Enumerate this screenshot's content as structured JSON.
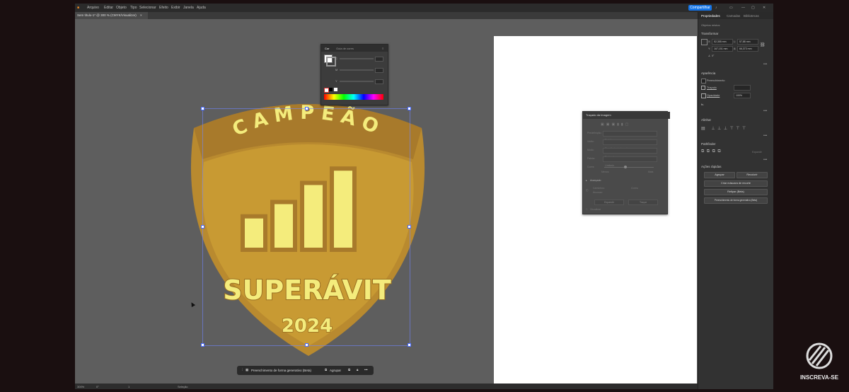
{
  "menubar": {
    "items": [
      "Arquivo",
      "Editar",
      "Objeto",
      "Tipo",
      "Selecionar",
      "Efeito",
      "Exibir",
      "Janela",
      "Ajuda"
    ],
    "share_label": "Compartilhar"
  },
  "document_tab": {
    "title": "Sem título-1* @ 300 % (CMYK/Visualizar)",
    "close": "×"
  },
  "status": {
    "zoom": "300%",
    "rotation": "0°",
    "artboard": "1",
    "tool": "Seleção"
  },
  "color_panel": {
    "tabs": [
      "Cor",
      "Guia de cores"
    ],
    "rows": [
      "C",
      "M",
      "Y"
    ]
  },
  "trace_panel": {
    "title": "Traçado da Imagem",
    "rows": [
      "Predefinição:",
      "Visão:",
      "Modo:",
      "Paleta:",
      "Cores:"
    ],
    "values": [
      "Padrão",
      "Resultado de traçado",
      "Preto e branco",
      "Limitado",
      ""
    ],
    "scale": [
      "Menos",
      "Mais"
    ],
    "advanced": "Avançado",
    "info": [
      "Caminhos:",
      "Âncoras:",
      "Cores:"
    ],
    "buttons": [
      "Expandir",
      "Traçar"
    ],
    "preview": "Visualizar"
  },
  "context_toolbar": {
    "generative_fill": "Preenchimento de forma generativo (Beta)",
    "group": "Agrupar",
    "more": "•••"
  },
  "right_panel": {
    "tabs": [
      "Propriedades",
      "Camadas",
      "Bibliotecas"
    ],
    "selection_label": "Objetos mistos",
    "transform_title": "Transformar",
    "transform_fields": {
      "x": "52,355 mm",
      "y": "167,151 mm",
      "w": "57,88 mm",
      "h": "66,373 mm",
      "angle": "0°"
    },
    "appearance_title": "Aparência",
    "fill_label": "Preenchimento",
    "stroke_label": "Traçado",
    "opacity_label": "Opacidade",
    "opacity_value": "100%",
    "fx_label": "fx.",
    "align_title": "Alinhar",
    "pathfinder_title": "Pathfinder",
    "pathfinder_expand": "Expandir",
    "quick_actions_title": "Ações rápidas",
    "quick_actions": {
      "group": "Agrupar",
      "recolor": "Recolorir",
      "clipping_mask": "Criar máscara de recorte",
      "retype": "Retipar (Beta)",
      "generative_fill": "Preenchimento de forma generativo (Beta)"
    }
  },
  "badge": {
    "top_text": "CAMPEÃO",
    "title": "SUPERÁVIT",
    "year": "2024",
    "bar_levels": [
      0.35,
      0.5,
      0.7,
      0.85
    ],
    "colors": {
      "outer": "#b98a2f",
      "inner": "#c89a33",
      "banner": "#a87a2b",
      "bar_fill": "#f4ec7c",
      "bar_stroke": "#a87a2b",
      "text_light": "#f4ec7c"
    }
  },
  "subscribe": {
    "label": "INSCREVA-SE",
    "icon": "slash-logo-icon"
  }
}
